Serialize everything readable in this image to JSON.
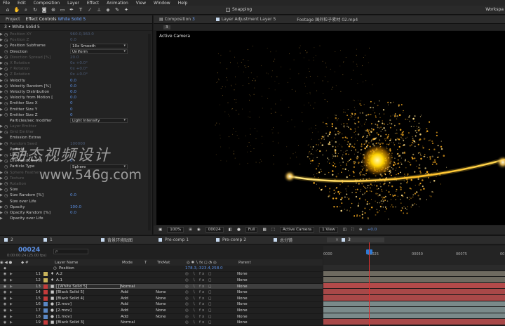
{
  "menu": [
    "File",
    "Edit",
    "Composition",
    "Layer",
    "Effect",
    "Animation",
    "View",
    "Window",
    "Help"
  ],
  "toolbar": {
    "snapping_label": "Snapping",
    "workspace_label": "Workspa",
    "tools": [
      "home-icon",
      "hand-icon",
      "zoom-icon",
      "rotate-icon",
      "camera-icon",
      "pan-behind-icon",
      "rectangle-icon",
      "pen-icon",
      "type-icon",
      "brush-icon",
      "clone-stamp-icon",
      "eraser-icon",
      "roto-brush-icon",
      "puppet-pin-icon"
    ]
  },
  "left_panel": {
    "tabs": [
      {
        "label": "Project",
        "prefix": "",
        "accent": ""
      },
      {
        "label": "Effect Controls",
        "prefix": "",
        "accent": "White Solid 5"
      }
    ],
    "subtitle": "3 • White Solid 5",
    "properties": [
      {
        "name": "Position XY",
        "value": "960.0,360.0",
        "dim": true,
        "tri": true
      },
      {
        "name": "Position Z",
        "value": "0.0",
        "dim": true,
        "tri": true
      },
      {
        "name": "Position Subframe",
        "dropdown": "10x Smooth",
        "tri": true
      },
      {
        "name": "Direction",
        "dropdown": "Uniform"
      },
      {
        "name": "Direction Spread [%]",
        "value": "20.0",
        "dim": true,
        "tri": true
      },
      {
        "name": "X Rotation",
        "value": "0x +0.0°",
        "dim": true,
        "tri": true
      },
      {
        "name": "Y Rotation",
        "value": "0x +0.0°",
        "dim": true,
        "tri": true
      },
      {
        "name": "Z Rotation",
        "value": "0x +0.0°",
        "dim": true,
        "tri": true
      },
      {
        "name": "Velocity",
        "value": "0.0",
        "tri": true
      },
      {
        "name": "Velocity Random [%]",
        "value": "0.0",
        "tri": true
      },
      {
        "name": "Velocity Distribution",
        "value": "0.0",
        "tri": true
      },
      {
        "name": "Velocity from Motion [",
        "value": "0.0",
        "tri": true
      },
      {
        "name": "Emitter Size X",
        "value": "0",
        "tri": true
      },
      {
        "name": "Emitter Size Y",
        "value": "0",
        "tri": true
      },
      {
        "name": "Emitter Size Z",
        "value": "0",
        "tri": true
      },
      {
        "name": "Particles/sec modifier",
        "dropdown": "Light Intensity",
        "nosw": true
      },
      {
        "name": "Layer Emitter",
        "value": "",
        "dim": true,
        "tri": true
      },
      {
        "name": "Grid Emitter",
        "value": "",
        "dim": true,
        "tri": true
      },
      {
        "name": "Emission Extras",
        "value": "",
        "tri": true,
        "nosw": true
      },
      {
        "name": "Random Seed",
        "value": "100000",
        "dim": true,
        "tri": true
      },
      {
        "name": "Particle",
        "value": "",
        "tri": true,
        "nosw": true
      },
      {
        "name": "Life [sec]",
        "value": "",
        "tri": true
      },
      {
        "name": "Life Random [%]",
        "value": "0",
        "tri": true
      },
      {
        "name": "Particle Type",
        "dropdown": "Sphere"
      },
      {
        "name": "Sphere Feather",
        "value": "",
        "dim": true,
        "tri": true
      },
      {
        "name": "Texture",
        "value": "",
        "dim": true,
        "tri": true
      },
      {
        "name": "Rotation",
        "value": "",
        "dim": true,
        "tri": true
      },
      {
        "name": "Size",
        "value": "",
        "tri": true
      },
      {
        "name": "Size Random [%]",
        "value": "0.0",
        "tri": true
      },
      {
        "name": "Size over Life",
        "value": "",
        "tri": true,
        "nosw": true
      },
      {
        "name": "Opacity",
        "value": "100.0",
        "tri": true
      },
      {
        "name": "Opacity Random [%]",
        "value": "0.0",
        "tri": true
      },
      {
        "name": "Opacity over Life",
        "value": "",
        "tri": true,
        "nosw": true
      }
    ]
  },
  "viewer": {
    "tabs": [
      {
        "label": "Composition",
        "accent": "3",
        "square": false
      },
      {
        "label": "Layer Adjustment Layer 5",
        "accent": "",
        "square": true
      },
      {
        "label": "Footage 国外粒子素材 02.mp4",
        "accent": "",
        "square": false
      }
    ],
    "sub_chip": "3",
    "canvas_label": "Active Camera",
    "bottom": {
      "zoom": "100%",
      "timecode": "00024",
      "resolution": "Full",
      "camera": "Active Camera",
      "view": "1 View",
      "exposure": "+0.0"
    }
  },
  "watermark": {
    "line1": "动态视频设计",
    "line2": "www.546g.com"
  },
  "timeline": {
    "tabs": [
      {
        "label": "2",
        "active": false
      },
      {
        "label": "1",
        "active": false
      },
      {
        "label": "背景环境贴图",
        "active": false
      },
      {
        "label": "Pre-comp 1",
        "active": false
      },
      {
        "label": "Pre-comp 2",
        "active": false
      },
      {
        "label": "总分镜",
        "active": false
      },
      {
        "label": "3",
        "active": true
      }
    ],
    "current_time": "00024",
    "frames_note": "0:00:00:24 (25.00 fps)",
    "search_placeholder": "ρ",
    "header": {
      "layer_name": "Layer Name",
      "mode": "Mode",
      "t": "T",
      "trkmat": "TrkMat",
      "parent": "Parent"
    },
    "ruler": [
      "0000",
      "00025",
      "00050",
      "00075",
      "0010"
    ],
    "rows": [
      {
        "num": "",
        "icon": "",
        "name": "Position",
        "mode": "",
        "trk": "",
        "parent": "",
        "value": "178.3,-323.4,258.0",
        "label_color": "",
        "position_row": true
      },
      {
        "num": "11",
        "icon": "♦",
        "name": "A.2",
        "mode": "",
        "trk": "",
        "parent": "None",
        "label_color": "#c8b35a"
      },
      {
        "num": "12",
        "icon": "♦",
        "name": "A.1",
        "mode": "",
        "trk": "",
        "parent": "None",
        "label_color": "#c8b35a"
      },
      {
        "num": "13",
        "icon": "■",
        "name": "[White Solid 5]",
        "mode": "Normal",
        "trk": "",
        "parent": "None",
        "label_color": "#c43b3b",
        "selected": true
      },
      {
        "num": "14",
        "icon": "■",
        "name": "[Black Solid 5]",
        "mode": "Add",
        "trk": "None",
        "parent": "None",
        "label_color": "#c43b3b"
      },
      {
        "num": "15",
        "icon": "■",
        "name": "[Black Solid 4]",
        "mode": "Add",
        "trk": "None",
        "parent": "None",
        "label_color": "#c43b3b"
      },
      {
        "num": "16",
        "icon": "●",
        "name": "[2.mov]",
        "mode": "Add",
        "trk": "None",
        "parent": "None",
        "label_color": "#5a87c4"
      },
      {
        "num": "17",
        "icon": "●",
        "name": "[2.mov]",
        "mode": "Add",
        "trk": "None",
        "parent": "None",
        "label_color": "#5a87c4"
      },
      {
        "num": "18",
        "icon": "●",
        "name": "[1.mov]",
        "mode": "Add",
        "trk": "None",
        "parent": "None",
        "label_color": "#5a87c4"
      },
      {
        "num": "19",
        "icon": "■",
        "name": "[Black Solid 3]",
        "mode": "Normal",
        "trk": "",
        "parent": "None",
        "label_color": "#c43b3b"
      }
    ],
    "bar_colors": [
      "#2b2b2b",
      "#6e6a60",
      "#6e6a60",
      "#b34a4a",
      "#a84848",
      "#a84848",
      "#7a8a8a",
      "#7a8a8a",
      "#7a8a8a",
      "#a84848"
    ]
  }
}
